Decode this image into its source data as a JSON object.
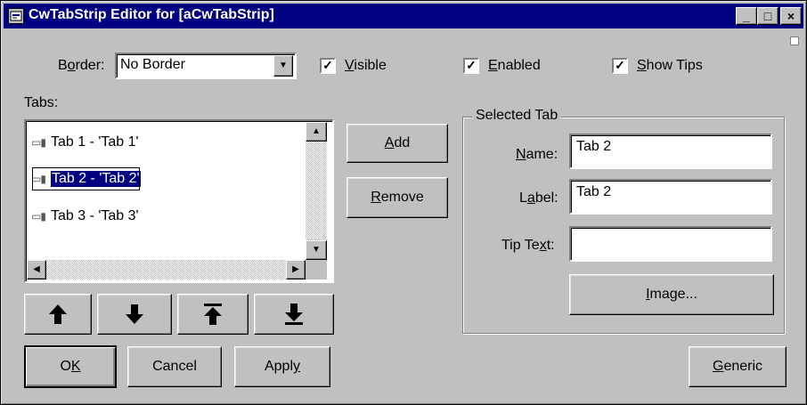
{
  "window": {
    "title": "CwTabStrip Editor for [aCwTabStrip]"
  },
  "titlebar_buttons": {
    "minimize": "_",
    "maximize": "□",
    "close": "×"
  },
  "border": {
    "label_pre": "B",
    "label_ul": "o",
    "label_post": "rder:",
    "selected": "No Border"
  },
  "checkboxes": {
    "visible": {
      "ul": "V",
      "rest": "isible",
      "checked": true
    },
    "enabled": {
      "ul": "E",
      "rest": "nabled",
      "checked": true
    },
    "show_tips": {
      "ul": "S",
      "rest": "how Tips",
      "checked": true
    }
  },
  "tabs_label": "Tabs:",
  "tabs_list": [
    {
      "label": "Tab 1 - 'Tab 1'",
      "selected": false
    },
    {
      "label": "Tab 2 - 'Tab 2'",
      "selected": true
    },
    {
      "label": "Tab 3 - 'Tab 3'",
      "selected": false
    }
  ],
  "buttons": {
    "add": {
      "ul": "A",
      "rest": "dd"
    },
    "remove": {
      "ul": "R",
      "rest": "emove"
    },
    "ok": {
      "pre": "O",
      "ul": "K"
    },
    "cancel": "Cancel",
    "apply": {
      "pre": "Appl",
      "ul": "y"
    },
    "generic": {
      "ul": "G",
      "rest": "eneric"
    },
    "image": {
      "ul": "I",
      "rest": "mage..."
    }
  },
  "selected_tab": {
    "group_title": "Selected Tab",
    "name": {
      "ul": "N",
      "rest": "ame:",
      "value": "Tab 2"
    },
    "label": {
      "pre": "L",
      "ul": "a",
      "rest": "bel:",
      "value": "Tab 2"
    },
    "tip_text": {
      "pre": "Tip Te",
      "ul": "x",
      "rest": "t:",
      "value": ""
    }
  },
  "glyphs": {
    "check": "✓",
    "tab_icon": "▭▮",
    "scroll_up": "▲",
    "scroll_down": "▼",
    "scroll_left": "◀",
    "scroll_right": "▶",
    "dropdown": "▼"
  }
}
